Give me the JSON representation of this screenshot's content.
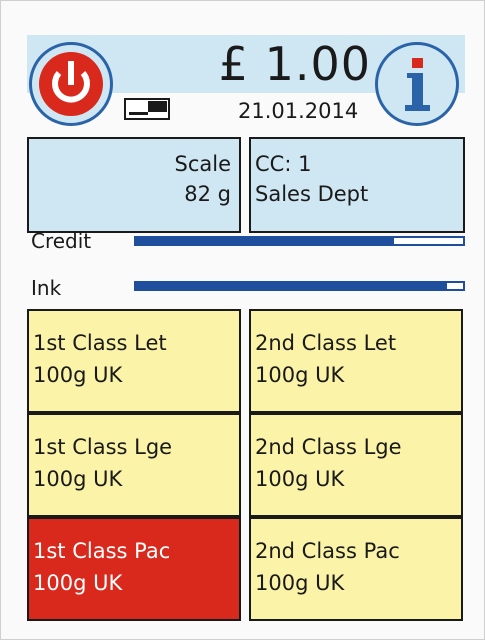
{
  "header": {
    "amount": "£ 1.00",
    "date": "21.01.2014",
    "power_icon": "power-icon",
    "info_icon": "info-icon",
    "toggle_icon": "mode-toggle-icon"
  },
  "scale_panel": {
    "label": "Scale",
    "value": "82 g"
  },
  "cost_centre_panel": {
    "code": "CC: 1",
    "name": "Sales Dept"
  },
  "levels": {
    "credit": {
      "label": "Credit",
      "fraction": 0.79
    },
    "ink": {
      "label": "Ink",
      "fraction": 0.95
    }
  },
  "services": [
    {
      "line1": "1st Class Let",
      "line2": "100g UK",
      "selected": false
    },
    {
      "line1": "2nd Class Let",
      "line2": "100g UK",
      "selected": false
    },
    {
      "line1": "1st Class Lge",
      "line2": "100g UK",
      "selected": false
    },
    {
      "line1": "2nd Class Lge",
      "line2": "100g UK",
      "selected": false
    },
    {
      "line1": "1st Class Pac",
      "line2": "100g UK",
      "selected": true
    },
    {
      "line1": "2nd Class Pac",
      "line2": "100g UK",
      "selected": false
    }
  ],
  "colors": {
    "header_bg": "#cfe6f3",
    "tile_bg": "#fbf3a8",
    "tile_selected": "#d9291c",
    "bar": "#1f4f9c",
    "power_red": "#d9291c",
    "info_blue": "#2a63a8"
  }
}
